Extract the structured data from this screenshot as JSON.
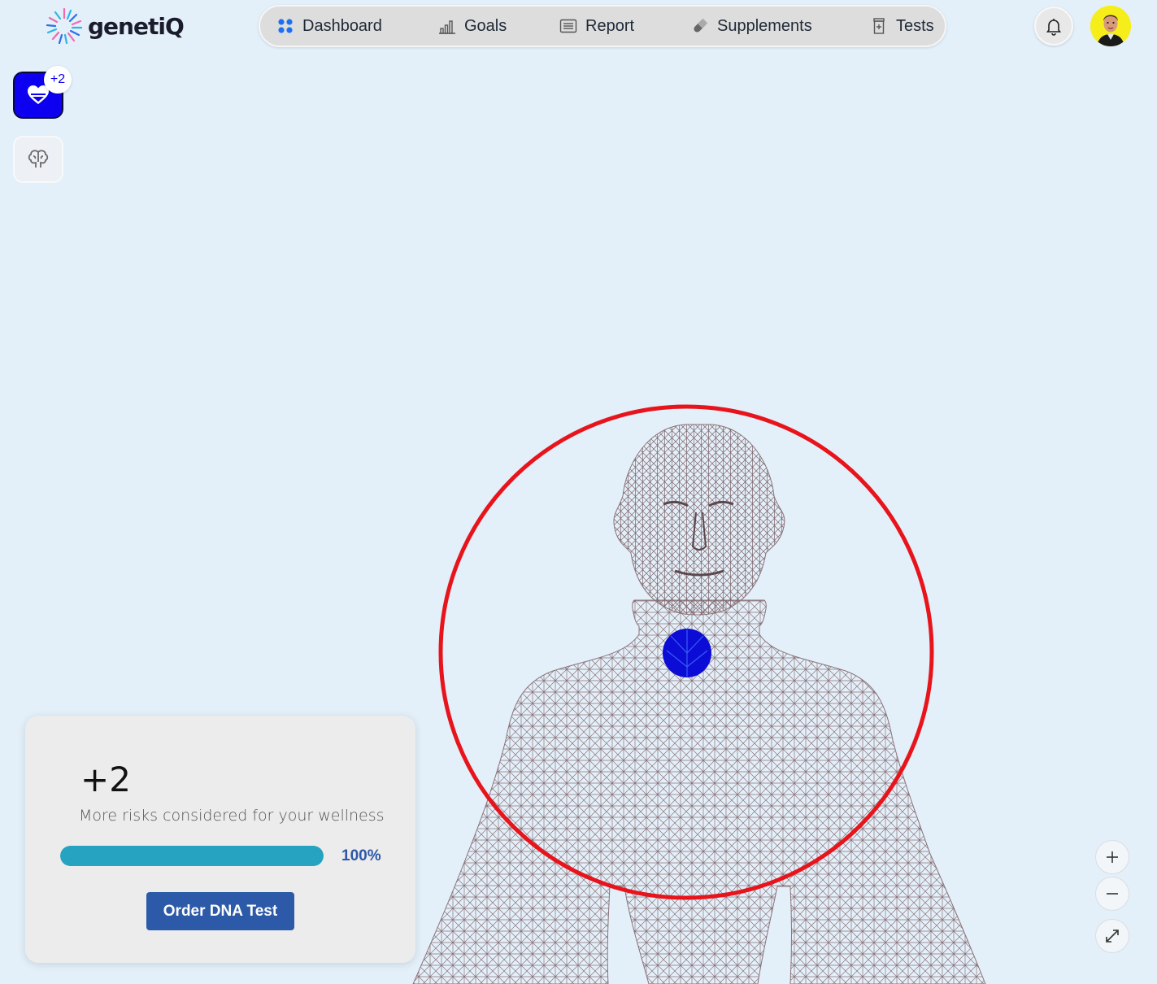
{
  "app": {
    "name": "genetiQ"
  },
  "nav": {
    "items": [
      {
        "label": "Dashboard",
        "icon": "grid-dots-icon"
      },
      {
        "label": "Goals",
        "icon": "bar-chart-icon"
      },
      {
        "label": "Report",
        "icon": "list-report-icon"
      },
      {
        "label": "Supplements",
        "icon": "pill-icon"
      },
      {
        "label": "Tests",
        "icon": "test-tube-icon"
      }
    ]
  },
  "header": {
    "bell_icon": "bell-icon",
    "avatar_icon": "user-avatar"
  },
  "rail": {
    "badge": "+2",
    "items": [
      {
        "name": "heart-risk-icon",
        "active": true
      },
      {
        "name": "brain-icon",
        "active": false
      }
    ]
  },
  "card": {
    "count": "+2",
    "description": "More risks considered for your wellness",
    "progress": 1.0,
    "progress_label": "100%",
    "button_label": "Order DNA Test"
  },
  "zoom": {
    "zoom_in": "plus-icon",
    "zoom_out": "minus-icon",
    "fullscreen": "expand-icon"
  },
  "colors": {
    "background": "#e3eff9",
    "accent_blue": "#0d00f0",
    "progress_fill": "#25a3c1",
    "button": "#2c5aa8",
    "highlight_ring": "#e8141c"
  }
}
